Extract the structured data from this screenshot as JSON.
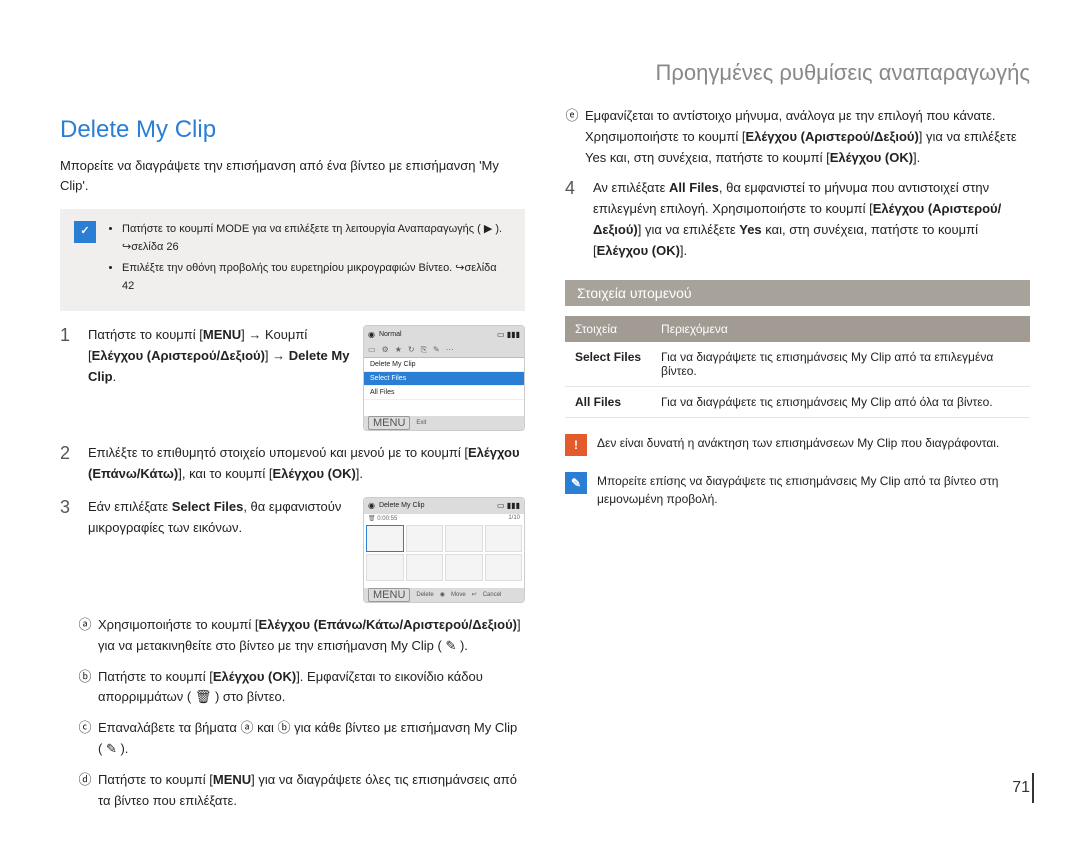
{
  "chapterTitle": "Προηγμένες ρυθμίσεις αναπαραγωγής",
  "sectionTitle": "Delete My Clip",
  "intro": "Μπορείτε να διαγράψετε την επισήμανση από ένα βίντεο με επισήμανση 'My Clip'.",
  "noteBullets": [
    "Πατήστε το κουμπί MODE για να επιλέξετε τη λειτουργία Αναπαραγωγής ( ▶ ). ↪σελίδα 26",
    "Επιλέξτε την οθόνη προβολής του ευρετηρίου μικρογραφιών Βίντεο. ↪σελίδα 42"
  ],
  "steps": {
    "s1": {
      "pieces": {
        "a": "Πατήστε το κουμπί [",
        "menu": "MENU",
        "b": "] → Κουμπί [",
        "ctrl": "Ελέγχου (Αριστερού/Δεξιού)",
        "c": "] → ",
        "dest": "Delete My Clip",
        "d": "."
      }
    },
    "s2": {
      "pieces": {
        "a": "Επιλέξτε το επιθυμητό στοιχείο υπομενού και μενού με το κουμπί [",
        "ctrl": "Ελέγχου (Επάνω/Κάτω)",
        "b": "], και το κουμπί [",
        "ok": "Ελέγχου (OK)",
        "c": "]."
      }
    },
    "s3": {
      "pieces": {
        "a": "Εάν επιλέξατε ",
        "sel": "Select Files",
        "b": ", θα εμφανιστούν μικρογραφίες των εικόνων."
      },
      "sub_a": {
        "a": "Χρησιμοποιήστε το κουμπί [",
        "ctrl": "Ελέγχου (Επάνω/Κάτω/Αριστερού/Δεξιού)",
        "b": "] για να μετακινηθείτε στο βίντεο με την επισήμανση My Clip ( ✎ )."
      },
      "sub_b": {
        "a": "Πατήστε το κουμπί [",
        "ok": "Ελέγχου (OK)",
        "b": "]. Εμφανίζεται το εικονίδιο κάδου απορριμμάτων ( 🗑 ) στο βίντεο."
      },
      "sub_c": "Επαναλάβετε τα βήματα ⓐ και ⓑ για κάθε βίντεο με επισήμανση My Clip ( ✎ ).",
      "sub_d": {
        "a": "Πατήστε το κουμπί [",
        "menu": "MENU",
        "b": "] για να διαγράψετε όλες τις επισημάνσεις από τα βίντεο που επιλέξατε."
      }
    },
    "s3e": {
      "a": "Εμφανίζεται το αντίστοιχο μήνυμα, ανάλογα με την επιλογή που κάνατε. Χρησιμοποιήστε το κουμπί [",
      "ctrl": "Ελέγχου (Αριστερού/Δεξιού)",
      "b": "] για να επιλέξετε Yes και, στη συνέχεια, πατήστε το κουμπί [",
      "ok": "Ελέγχου (OK)",
      "c": "]."
    },
    "s4": {
      "a": "Αν επιλέξατε ",
      "all": "All Files",
      "b": ", θα εμφανιστεί το μήνυμα που αντιστοιχεί στην επιλεγμένη επιλογή. Χρησιμοποιήστε το κουμπί [",
      "ctrl": "Ελέγχου (Αριστερού/Δεξιού)",
      "c": "] για να επιλέξετε ",
      "yes": "Yes",
      "d": " και, στη συνέχεια, πατήστε το κουμπί [",
      "ok": "Ελέγχου (OK)",
      "e": "]."
    }
  },
  "screen1": {
    "titleBar": "Normal",
    "menuItems": [
      "Delete My Clip",
      "Select Files",
      "All Files"
    ],
    "exitLabel": "Exit",
    "menuBtn": "MENU"
  },
  "screen2": {
    "titleBar": "Delete My Clip",
    "time": "0:00:55",
    "count": "1/10",
    "footer": {
      "delete": "Delete",
      "move": "Move",
      "cancel": "Cancel",
      "menuBtn": "MENU"
    }
  },
  "submenuHeading": "Στοιχεία υπομενού",
  "table": {
    "head": {
      "item": "Στοιχεία",
      "desc": "Περιεχόμενα"
    },
    "rows": [
      {
        "item": "Select Files",
        "desc": "Για να διαγράψετε τις επισημάνσεις My Clip από τα επιλεγμένα βίντεο."
      },
      {
        "item": "All Files",
        "desc": "Για να διαγράψετε τις επισημάνσεις My Clip από όλα τα βίντεο."
      }
    ]
  },
  "warnText": "Δεν είναι δυνατή η ανάκτηση των επισημάνσεων My Clip που διαγράφονται.",
  "noteText": "Μπορείτε επίσης να διαγράψετε τις επισημάνσεις My Clip από τα βίντεο στη μεμονωμένη προβολή.",
  "pageNum": "71"
}
